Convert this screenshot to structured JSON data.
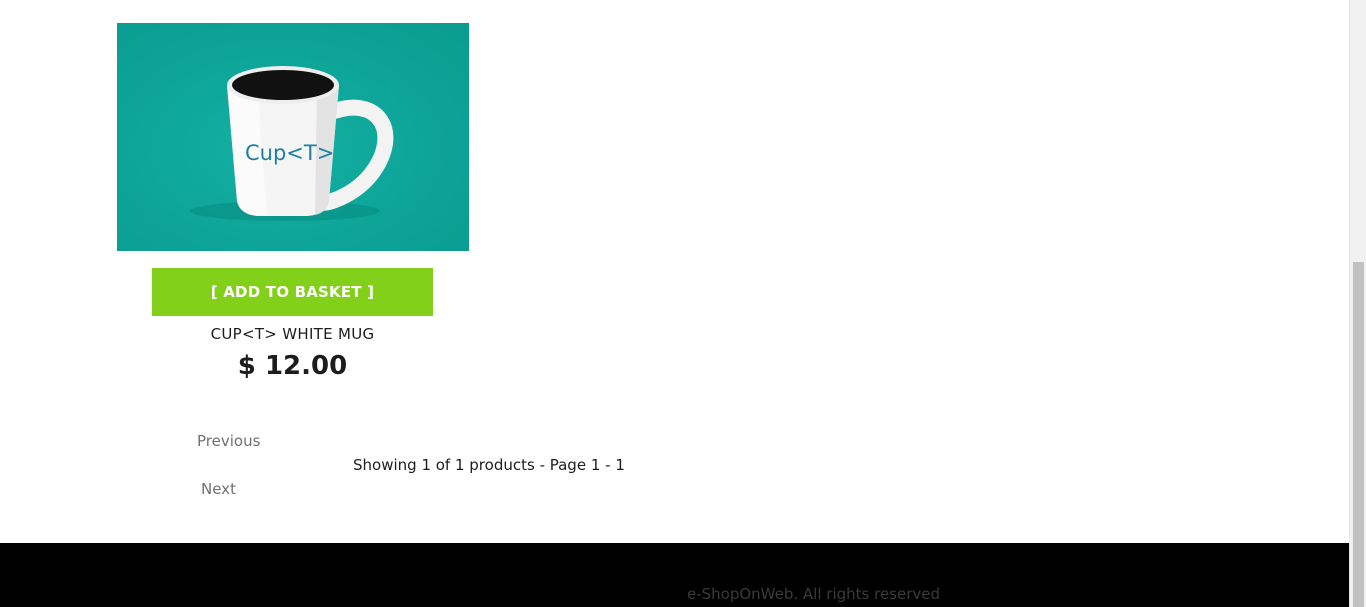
{
  "product": {
    "image_alt": "Cup<T> White Mug",
    "mug_text": "Cup<T>",
    "add_to_basket_label": "[ ADD TO BASKET ]",
    "name": "CUP<T> WHITE MUG",
    "price": "$ 12.00"
  },
  "pager": {
    "previous_label": "Previous",
    "next_label": "Next",
    "info": "Showing 1 of 1 products - Page 1 - 1"
  },
  "footer": {
    "text": "e-ShopOnWeb. All rights reserved"
  },
  "colors": {
    "button": "#83d01b",
    "image_background": "#0ea89b",
    "footer_background": "#000000"
  }
}
